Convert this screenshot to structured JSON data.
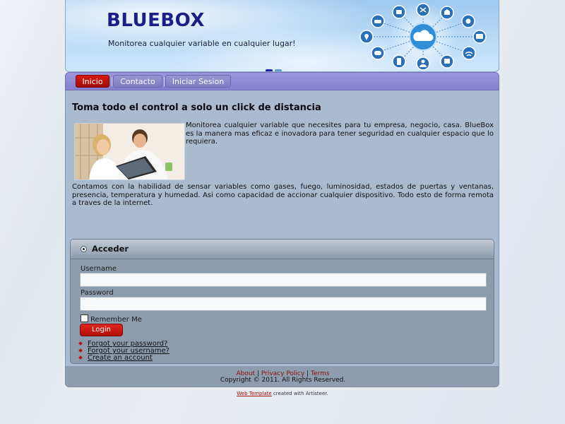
{
  "header": {
    "logo": "BLUEBOX",
    "slogan": "Monitorea cualquier variable en cualquier lugar!",
    "slide_count": 2,
    "active_slide": 1
  },
  "nav": {
    "items": [
      {
        "label": "Inicio",
        "active": true
      },
      {
        "label": "Contacto",
        "active": false
      },
      {
        "label": "Iniciar Sesion",
        "active": false
      }
    ]
  },
  "main": {
    "headline": "Toma todo el control a solo un click de distancia",
    "paragraph1": "Monitorea cualquier variable que necesites para tu empresa, negocio, casa. BlueBox es la manera mas eficaz e inovadora para tener seguridad en cualquier espacio que lo requiera.",
    "paragraph2": "Contamos con la habilidad de sensar variables como gases, fuego, luminosidad, estados de puertas y ventanas, presencia, temperatura y humedad. Asi como capacidad de accionar cualquier dispositivo. Todo esto de forma remota a traves de la internet."
  },
  "login": {
    "title": "Acceder",
    "username_label": "Username",
    "username_value": "",
    "password_label": "Password",
    "password_value": "",
    "remember_label": "Remember Me",
    "remember_checked": false,
    "submit_label": "Login",
    "links": [
      "Forgot your password?",
      "Forgot your username?",
      "Create an account"
    ]
  },
  "footer": {
    "about": "About",
    "privacy": "Privacy Policy",
    "terms": "Terms",
    "separator": "|",
    "copyright": "Copyright © 2011. All Rights Reserved."
  },
  "credit": {
    "link": "Web Template",
    "text": "created with Artisteer."
  },
  "colors": {
    "logo": "#1b1f8a",
    "nav_bg": "#8480cf",
    "nav_active": "#c4150e",
    "content_bg": "#aabbd0",
    "login_bg": "#8d9cad",
    "link_red": "#8b0f0a"
  }
}
